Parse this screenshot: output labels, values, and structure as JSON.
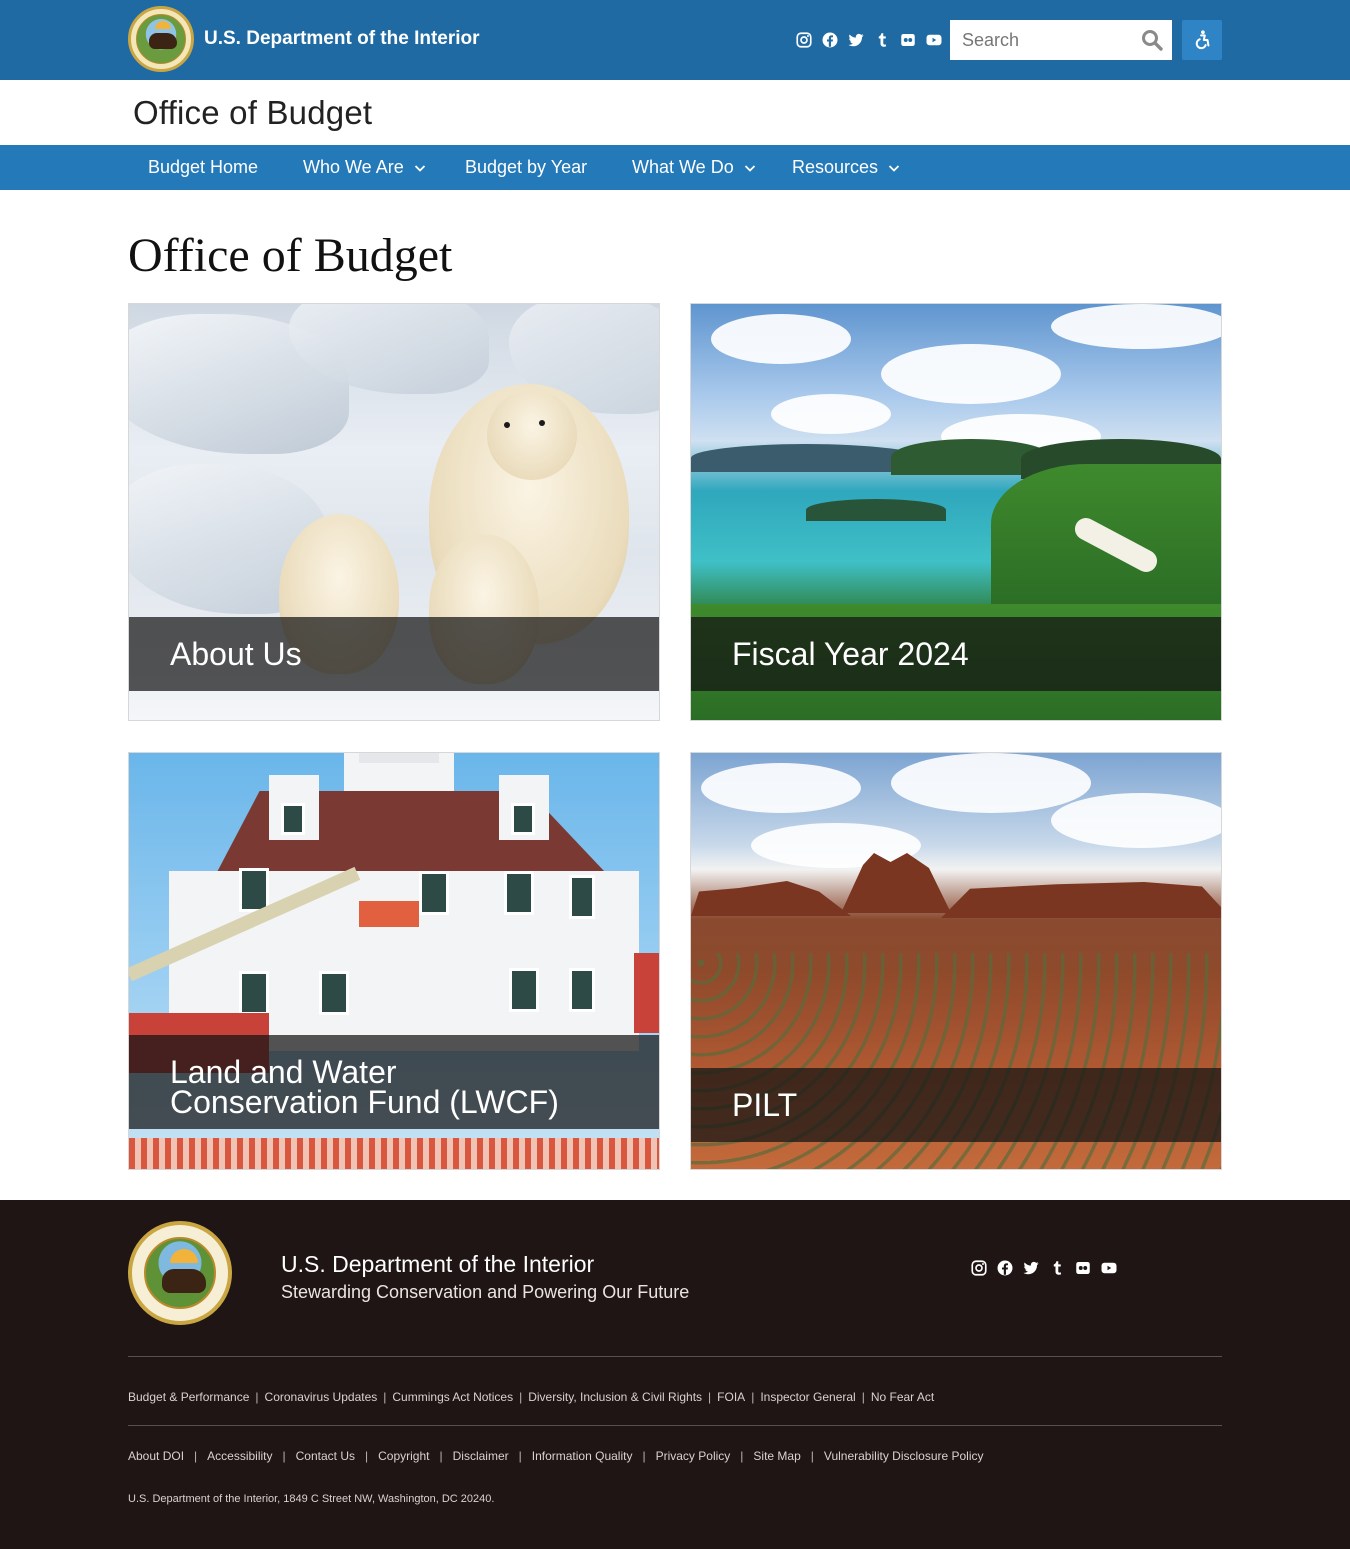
{
  "header": {
    "brand": "U.S. Department of the Interior",
    "search_placeholder": "Search",
    "social_icons": [
      "instagram-icon",
      "facebook-icon",
      "twitter-icon",
      "tumblr-icon",
      "flickr-icon",
      "youtube-icon"
    ],
    "accessibility_icon": "accessibility-icon"
  },
  "site": {
    "title": "Office of Budget"
  },
  "nav": {
    "items": [
      {
        "label": "Budget Home",
        "dropdown": false
      },
      {
        "label": "Who We Are",
        "dropdown": true
      },
      {
        "label": "Budget by Year",
        "dropdown": false
      },
      {
        "label": "What We Do",
        "dropdown": true
      },
      {
        "label": "Resources",
        "dropdown": true
      }
    ]
  },
  "main": {
    "title": "Office of Budget",
    "cards": [
      {
        "caption": "About Us"
      },
      {
        "caption": "Fiscal Year 2024"
      },
      {
        "caption_line1": "Land and Water",
        "caption_line2": "Conservation Fund (LWCF)"
      },
      {
        "caption": "PILT"
      }
    ]
  },
  "footer": {
    "title": "U.S. Department of the Interior",
    "tagline": "Stewarding Conservation and Powering Our Future",
    "links_row1": [
      "Budget & Performance",
      "Coronavirus Updates",
      "Cummings Act Notices",
      "Diversity, Inclusion & Civil Rights",
      "FOIA",
      "Inspector General",
      "No Fear Act"
    ],
    "links_row2": [
      "About DOI",
      "Accessibility",
      "Contact Us",
      "Copyright",
      "Disclaimer",
      "Information Quality",
      "Privacy Policy",
      "Site Map",
      "Vulnerability Disclosure Policy"
    ],
    "address": "U.S. Department of the Interior, 1849 C Street NW, Washington, DC 20240."
  },
  "colors": {
    "topbar": "#1f6aa3",
    "nav": "#2479b9",
    "footer": "#1f1514"
  }
}
